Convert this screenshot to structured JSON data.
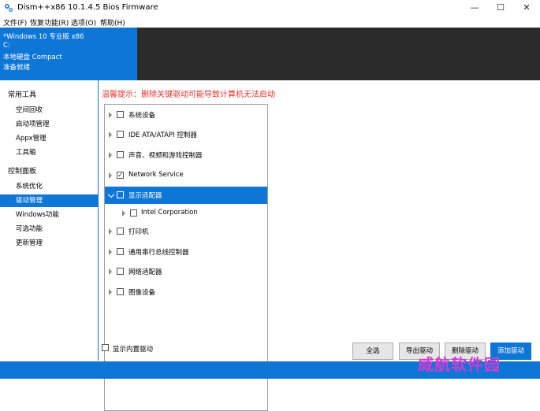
{
  "window": {
    "title": "Dism++x86 10.1.4.5 Bios Firmware",
    "minimize": "—",
    "maximize": "☐",
    "close": "✕"
  },
  "menu": [
    "文件(F)",
    "恢复功能(R)",
    "选项(O)",
    "帮助(H)"
  ],
  "system": {
    "os": "*Windows 10 专业版 x86",
    "drive": "C:",
    "disk": "本地硬盘 Compact",
    "status": "准备就绪"
  },
  "sidebar": {
    "groups": [
      {
        "label": "常用工具",
        "items": [
          "空间回收",
          "启动项管理",
          "Appx管理",
          "工具箱"
        ]
      },
      {
        "label": "控制面板",
        "items": [
          "系统优化",
          "驱动管理",
          "Windows功能",
          "可选功能",
          "更新管理"
        ]
      }
    ],
    "active": "驱动管理"
  },
  "main": {
    "warning": "温馨提示：删除关键驱动可能导致计算机无法启动",
    "tree": [
      {
        "label": "系统设备",
        "checked": false,
        "expanded": false,
        "selected": false,
        "level": 0
      },
      {
        "label": "IDE ATA/ATAPI 控制器",
        "checked": false,
        "expanded": false,
        "selected": false,
        "level": 0
      },
      {
        "label": "声音、视频和游戏控制器",
        "checked": false,
        "expanded": false,
        "selected": false,
        "level": 0
      },
      {
        "label": "Network Service",
        "checked": true,
        "expanded": false,
        "selected": false,
        "level": 0
      },
      {
        "label": "显示适配器",
        "checked": false,
        "expanded": true,
        "selected": true,
        "level": 0
      },
      {
        "label": "Intel Corporation",
        "checked": false,
        "expanded": false,
        "selected": false,
        "level": 1
      },
      {
        "label": "打印机",
        "checked": false,
        "expanded": false,
        "selected": false,
        "level": 0
      },
      {
        "label": "通用串行总线控制器",
        "checked": false,
        "expanded": false,
        "selected": false,
        "level": 0
      },
      {
        "label": "网络适配器",
        "checked": false,
        "expanded": false,
        "selected": false,
        "level": 0
      },
      {
        "label": "图像设备",
        "checked": false,
        "expanded": false,
        "selected": false,
        "level": 0
      }
    ],
    "show_builtin_label": "显示内置驱动",
    "buttons": {
      "select_all": "全选",
      "export": "导出驱动",
      "delete": "删除驱动",
      "add": "添加驱动"
    }
  },
  "watermark": "威航软件园",
  "colors": {
    "accent": "#0e76d6",
    "warning": "#e0322d",
    "header_dark": "#2b2b2b"
  }
}
